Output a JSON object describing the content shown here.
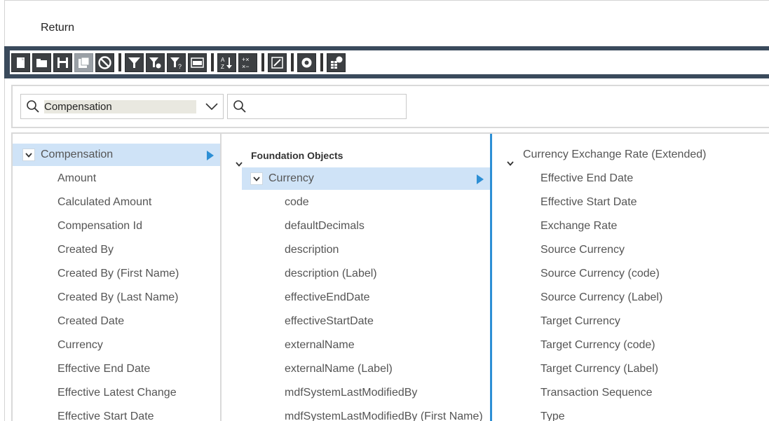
{
  "header": {
    "return_label": "Return"
  },
  "toolbar": {
    "buttons": [
      {
        "name": "new-icon",
        "disabled": false
      },
      {
        "name": "open-folder-icon",
        "disabled": false
      },
      {
        "name": "save-icon",
        "disabled": false
      },
      {
        "name": "save-as-icon",
        "disabled": true
      },
      {
        "name": "cancel-icon",
        "disabled": false
      },
      {
        "name": "filter-icon",
        "disabled": false
      },
      {
        "name": "filter-settings-icon",
        "disabled": false
      },
      {
        "name": "filter-prompt-icon",
        "disabled": false
      },
      {
        "name": "join-icon",
        "disabled": false
      },
      {
        "name": "sort-icon",
        "disabled": false
      },
      {
        "name": "calculation-icon",
        "disabled": false
      },
      {
        "name": "relation-icon",
        "disabled": false
      },
      {
        "name": "settings-gear-icon",
        "disabled": false
      },
      {
        "name": "schedule-grid-icon",
        "disabled": false
      }
    ]
  },
  "filters": {
    "entity_select_value": "Compensation",
    "search_placeholder": ""
  },
  "col1": {
    "root": "Compensation",
    "items": [
      "Amount",
      "Calculated Amount",
      "Compensation Id",
      "Created By",
      "Created By (First Name)",
      "Created By (Last Name)",
      "Created Date",
      "Currency",
      "Effective End Date",
      "Effective Latest Change",
      "Effective Start Date"
    ]
  },
  "col2": {
    "group": "Foundation Objects",
    "selected": "Currency",
    "items": [
      "code",
      "defaultDecimals",
      "description",
      "description (Label)",
      "effectiveEndDate",
      "effectiveStartDate",
      "externalName",
      "externalName (Label)",
      "mdfSystemLastModifiedBy",
      "mdfSystemLastModifiedBy (First Name)"
    ]
  },
  "col3": {
    "root": "Currency Exchange Rate (Extended)",
    "items": [
      "Effective End Date",
      "Effective Start Date",
      "Exchange Rate",
      "Source Currency",
      "Source Currency (code)",
      "Source Currency (Label)",
      "Target Currency",
      "Target Currency (code)",
      "Target Currency (Label)",
      "Transaction Sequence",
      "Type"
    ]
  },
  "colors": {
    "selection": "#cfe3f7",
    "accent": "#2d8fd5",
    "toolbar_frame": "#3a4a5c"
  }
}
